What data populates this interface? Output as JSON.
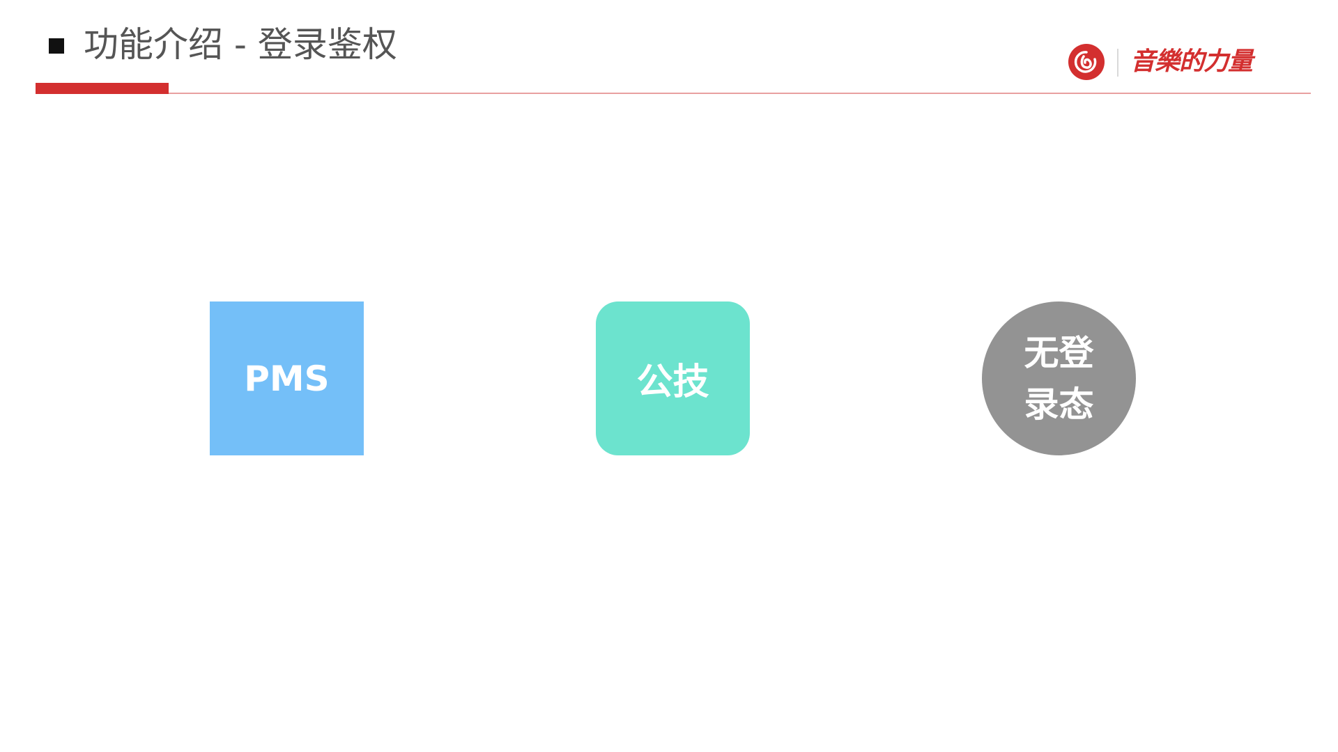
{
  "header": {
    "title": "功能介绍 - 登录鉴权",
    "brand_slogan": "音樂的力量",
    "brand_logo_icon": "netease-cloud-music-logo-icon"
  },
  "colors": {
    "accent_red": "#d32f2f",
    "divider_pink": "#e8a0a0",
    "pms_blue": "#74bff8",
    "gongji_teal": "#6ce3ce",
    "anon_gray": "#939393"
  },
  "auth_nodes": {
    "pms": {
      "label": "PMS",
      "shape": "square"
    },
    "gongji": {
      "label": "公技",
      "shape": "rounded-square"
    },
    "anon": {
      "line1": "无登",
      "line2": "录态",
      "shape": "circle"
    }
  }
}
